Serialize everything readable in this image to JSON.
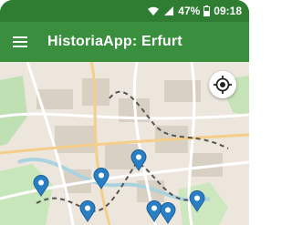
{
  "status_bar": {
    "battery": "47%",
    "time": "09:18",
    "icons": [
      "wifi-icon",
      "signal-icon",
      "battery-icon"
    ]
  },
  "app_bar": {
    "title": "HistoriaApp: Erfurt",
    "menu_icon": "hamburger-menu-icon"
  },
  "map": {
    "locate_icon": "gps-locate-icon",
    "markers": [
      {
        "name": "map-marker-1"
      },
      {
        "name": "map-marker-2"
      },
      {
        "name": "map-marker-3"
      },
      {
        "name": "map-marker-4"
      },
      {
        "name": "map-marker-5"
      },
      {
        "name": "map-marker-6"
      },
      {
        "name": "map-marker-7"
      }
    ]
  },
  "colors": {
    "status_bar": "#2e7d32",
    "app_bar": "#3a8f3f",
    "marker": "#2a7fc4",
    "route": "#555555"
  }
}
